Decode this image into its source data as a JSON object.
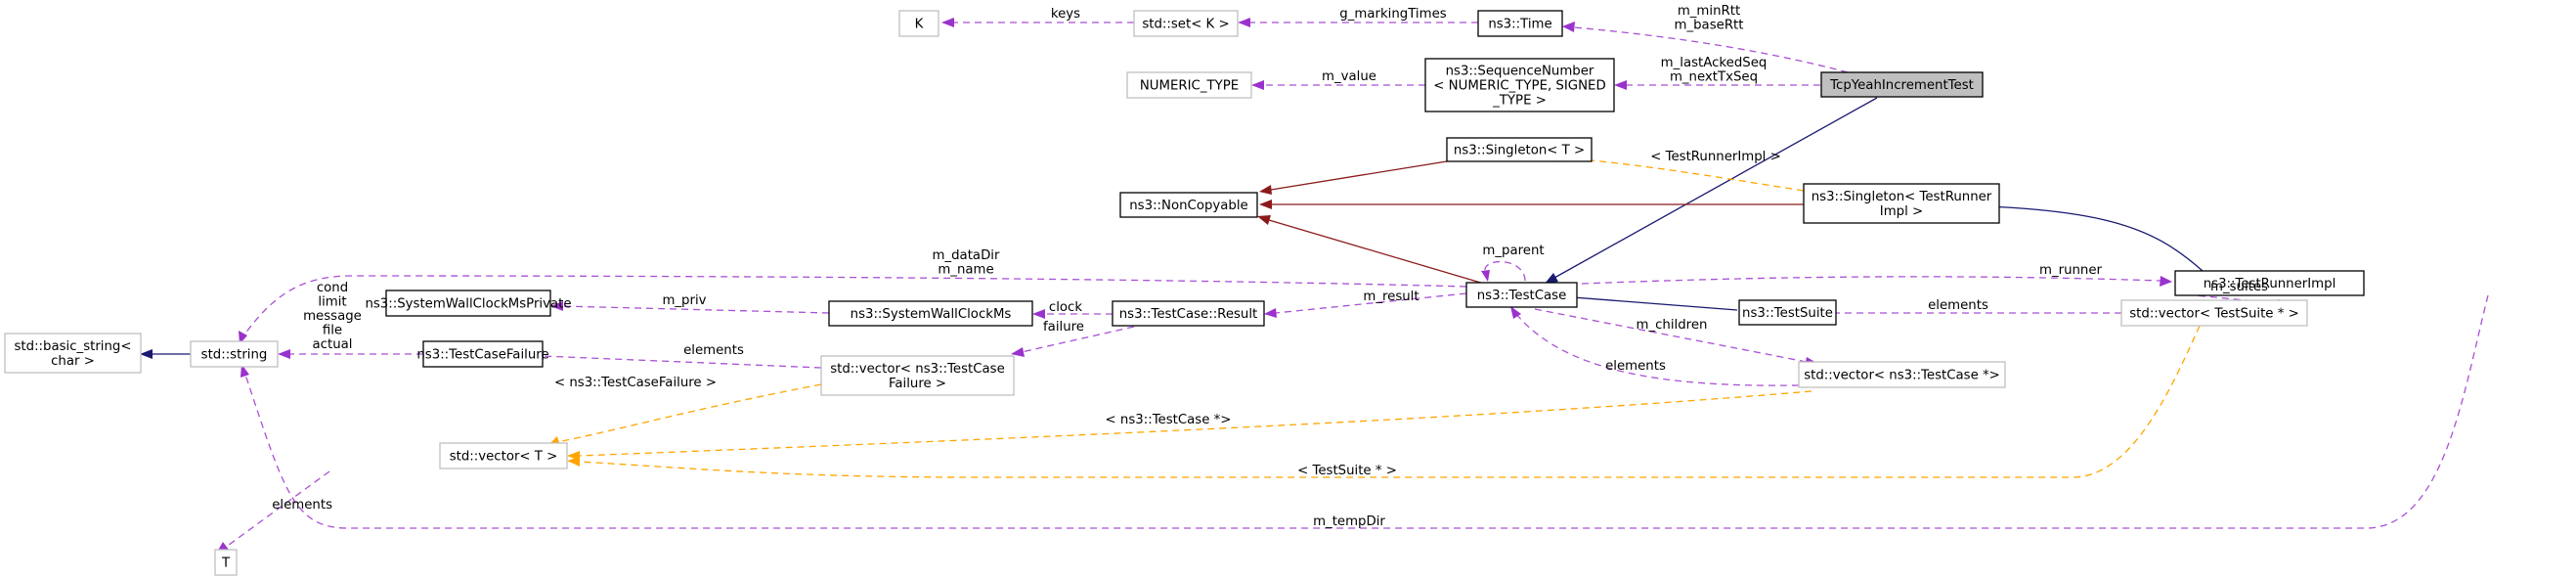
{
  "diagram": {
    "type": "collaboration-graph",
    "focus_node": "TcpYeahIncrementTest",
    "colors": {
      "usage_edge": "#9a32cd",
      "template_edge": "#ffa500",
      "public_inheritance": "#191970",
      "private_inheritance": "#8b1a1a",
      "focus_fill": "#bfbfbf",
      "documented_border": "#000000",
      "undocumented_border": "#bfbfbf"
    },
    "nodes": {
      "K": {
        "lines": [
          "K"
        ]
      },
      "set_k": {
        "lines": [
          "std::set< K >"
        ]
      },
      "time": {
        "lines": [
          "ns3::Time"
        ]
      },
      "tcp_yeah": {
        "lines": [
          "TcpYeahIncrementTest"
        ]
      },
      "numeric_type": {
        "lines": [
          "NUMERIC_TYPE"
        ]
      },
      "seqnum": {
        "lines": [
          "ns3::SequenceNumber",
          "< NUMERIC_TYPE, SIGNED",
          "_TYPE >"
        ]
      },
      "singleton_t": {
        "lines": [
          "ns3::Singleton< T >"
        ]
      },
      "noncopyable": {
        "lines": [
          "ns3::NonCopyable"
        ]
      },
      "singleton_tri": {
        "lines": [
          "ns3::Singleton< TestRunner",
          "Impl >"
        ]
      },
      "testcase": {
        "lines": [
          "ns3::TestCase"
        ]
      },
      "testrunnerimpl": {
        "lines": [
          "ns3::TestRunnerImpl"
        ]
      },
      "basic_string": {
        "lines": [
          "std::basic_string<",
          "char >"
        ]
      },
      "string": {
        "lines": [
          "std::string"
        ]
      },
      "swcm_private": {
        "lines": [
          "ns3::SystemWallClockMsPrivate"
        ]
      },
      "swcm": {
        "lines": [
          "ns3::SystemWallClockMs"
        ]
      },
      "result": {
        "lines": [
          "ns3::TestCase::Result"
        ]
      },
      "testsuite": {
        "lines": [
          "ns3::TestSuite"
        ]
      },
      "vec_suite": {
        "lines": [
          "std::vector< TestSuite * >"
        ]
      },
      "tcfailure": {
        "lines": [
          "ns3::TestCaseFailure"
        ]
      },
      "vec_tcfailure": {
        "lines": [
          "std::vector< ns3::TestCase",
          "Failure >"
        ]
      },
      "vec_tc": {
        "lines": [
          "std::vector< ns3::TestCase *>"
        ]
      },
      "vec_t": {
        "lines": [
          "std::vector< T >"
        ]
      },
      "T": {
        "lines": [
          "T"
        ]
      }
    },
    "edge_labels": {
      "keys": [
        "keys"
      ],
      "g_markingTimes": [
        "g_markingTimes"
      ],
      "rtt": [
        "m_minRtt",
        "m_baseRtt"
      ],
      "seq": [
        "m_lastAckedSeq",
        "m_nextTxSeq"
      ],
      "m_value": [
        "m_value"
      ],
      "tri_template": [
        "< TestRunnerImpl >"
      ],
      "m_parent": [
        "m_parent"
      ],
      "dir_name": [
        "m_dataDir",
        "m_name"
      ],
      "m_runner": [
        "m_runner"
      ],
      "m_suites": [
        "m_suites"
      ],
      "string_fields": [
        "cond",
        "limit",
        "message",
        "file",
        "actual"
      ],
      "m_priv": [
        "m_priv"
      ],
      "clock": [
        "clock"
      ],
      "m_result": [
        "m_result"
      ],
      "failure": [
        "failure"
      ],
      "suite_elements": [
        "elements"
      ],
      "m_children": [
        "m_children"
      ],
      "tcf_elements": [
        "elements"
      ],
      "tc_elements": [
        "elements"
      ],
      "tcf_template": [
        "< ns3::TestCaseFailure >"
      ],
      "tc_template": [
        "< ns3::TestCase *>"
      ],
      "suite_template": [
        "< TestSuite * >"
      ],
      "t_elements": [
        "elements"
      ],
      "m_tempDir": [
        "m_tempDir"
      ]
    }
  }
}
